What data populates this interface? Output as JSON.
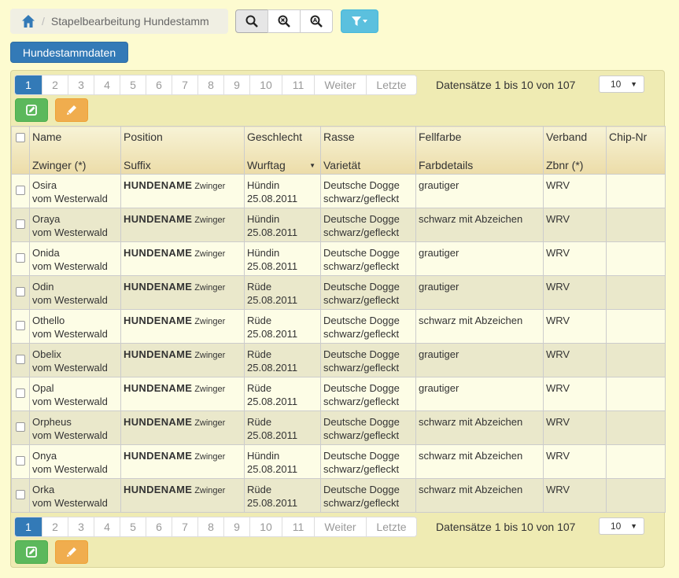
{
  "breadcrumb": {
    "current": "Stapelbearbeitung Hundestamm"
  },
  "toolbar": {
    "search_icon": "search-icon",
    "zoom_out_icon": "zoom-out-icon",
    "zoom_reset_icon": "zoom-reset-icon",
    "filter_icon": "filter-icon"
  },
  "stamm_button": "Hundestammdaten",
  "pagination": {
    "pages": [
      "1",
      "2",
      "3",
      "4",
      "5",
      "6",
      "7",
      "8",
      "9",
      "10",
      "11"
    ],
    "next": "Weiter",
    "last": "Letzte",
    "active": "1"
  },
  "records_info": "Datensätze 1 bis 10 von 107",
  "page_size": "10",
  "columns": [
    {
      "top": "Name",
      "bottom": "Zwinger (*)"
    },
    {
      "top": "Position",
      "bottom": "Suffix"
    },
    {
      "top": "Geschlecht",
      "bottom": "Wurftag"
    },
    {
      "top": "Rasse",
      "bottom": "Varietät"
    },
    {
      "top": "Fellfarbe",
      "bottom": "Farbdetails"
    },
    {
      "top": "Verband",
      "bottom": "Zbnr (*)"
    },
    {
      "top": "Chip-Nr",
      "bottom": ""
    }
  ],
  "rows": [
    {
      "name": "Osira",
      "zwinger": "vom Westerwald",
      "pos": "HUNDENAME",
      "suffix": "Zwinger",
      "sex": "Hündin",
      "date": "25.08.2011",
      "breed": "Deutsche Dogge",
      "variety": "schwarz/gefleckt",
      "color": "grautiger",
      "verband": "WRV",
      "chip": ""
    },
    {
      "name": "Oraya",
      "zwinger": "vom Westerwald",
      "pos": "HUNDENAME",
      "suffix": "Zwinger",
      "sex": "Hündin",
      "date": "25.08.2011",
      "breed": "Deutsche Dogge",
      "variety": "schwarz/gefleckt",
      "color": "schwarz mit Abzeichen",
      "verband": "WRV",
      "chip": ""
    },
    {
      "name": "Onida",
      "zwinger": "vom Westerwald",
      "pos": "HUNDENAME",
      "suffix": "Zwinger",
      "sex": "Hündin",
      "date": "25.08.2011",
      "breed": "Deutsche Dogge",
      "variety": "schwarz/gefleckt",
      "color": "grautiger",
      "verband": "WRV",
      "chip": ""
    },
    {
      "name": "Odin",
      "zwinger": "vom Westerwald",
      "pos": "HUNDENAME",
      "suffix": "Zwinger",
      "sex": "Rüde",
      "date": "25.08.2011",
      "breed": "Deutsche Dogge",
      "variety": "schwarz/gefleckt",
      "color": "grautiger",
      "verband": "WRV",
      "chip": ""
    },
    {
      "name": "Othello",
      "zwinger": "vom Westerwald",
      "pos": "HUNDENAME",
      "suffix": "Zwinger",
      "sex": "Rüde",
      "date": "25.08.2011",
      "breed": "Deutsche Dogge",
      "variety": "schwarz/gefleckt",
      "color": "schwarz mit Abzeichen",
      "verband": "WRV",
      "chip": ""
    },
    {
      "name": "Obelix",
      "zwinger": "vom Westerwald",
      "pos": "HUNDENAME",
      "suffix": "Zwinger",
      "sex": "Rüde",
      "date": "25.08.2011",
      "breed": "Deutsche Dogge",
      "variety": "schwarz/gefleckt",
      "color": "grautiger",
      "verband": "WRV",
      "chip": ""
    },
    {
      "name": "Opal",
      "zwinger": "vom Westerwald",
      "pos": "HUNDENAME",
      "suffix": "Zwinger",
      "sex": "Rüde",
      "date": "25.08.2011",
      "breed": "Deutsche Dogge",
      "variety": "schwarz/gefleckt",
      "color": "grautiger",
      "verband": "WRV",
      "chip": ""
    },
    {
      "name": "Orpheus",
      "zwinger": "vom Westerwald",
      "pos": "HUNDENAME",
      "suffix": "Zwinger",
      "sex": "Rüde",
      "date": "25.08.2011",
      "breed": "Deutsche Dogge",
      "variety": "schwarz/gefleckt",
      "color": "schwarz mit Abzeichen",
      "verband": "WRV",
      "chip": ""
    },
    {
      "name": "Onya",
      "zwinger": "vom Westerwald",
      "pos": "HUNDENAME",
      "suffix": "Zwinger",
      "sex": "Hündin",
      "date": "25.08.2011",
      "breed": "Deutsche Dogge",
      "variety": "schwarz/gefleckt",
      "color": "schwarz mit Abzeichen",
      "verband": "WRV",
      "chip": ""
    },
    {
      "name": "Orka",
      "zwinger": "vom Westerwald",
      "pos": "HUNDENAME",
      "suffix": "Zwinger",
      "sex": "Rüde",
      "date": "25.08.2011",
      "breed": "Deutsche Dogge",
      "variety": "schwarz/gefleckt",
      "color": "schwarz mit Abzeichen",
      "verband": "WRV",
      "chip": ""
    }
  ],
  "colors": {
    "primary": "#337ab7",
    "info": "#5bc0de",
    "success": "#5cb85c",
    "warning": "#f0ad4e",
    "panel": "#efebb3"
  },
  "icons": {
    "edit": "edit-icon",
    "pencil": "pencil-icon",
    "home": "home-icon",
    "sort": "sort-desc-icon"
  }
}
